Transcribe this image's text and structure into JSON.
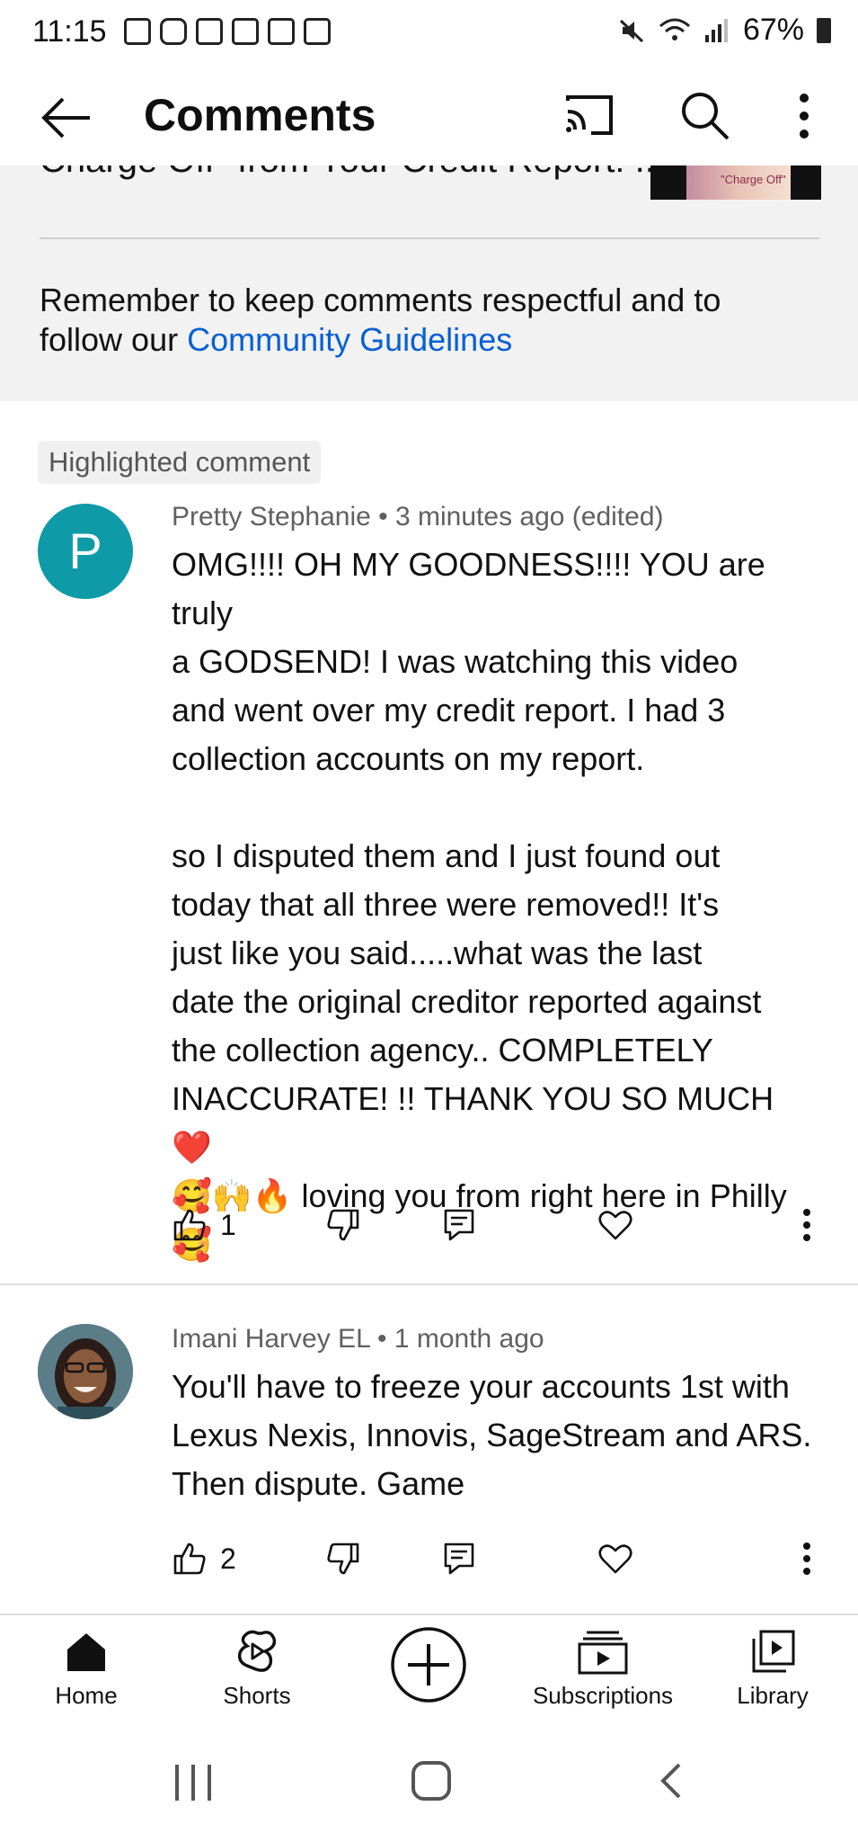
{
  "status_bar": {
    "time": "11:15",
    "battery": "67%"
  },
  "header": {
    "title": "Comments"
  },
  "video": {
    "title": "Charge Off\" from Your Credit Report! ...",
    "thumbnail_caption": "\"Charge Off\""
  },
  "reminder": {
    "text": "Remember to keep comments respectful and to follow our ",
    "link": "Community Guidelines"
  },
  "highlighted_label": "Highlighted comment",
  "comments": [
    {
      "avatar_letter": "P",
      "author": "Pretty Stephanie",
      "time": "3 minutes ago (edited)",
      "text": "OMG!!!! OH MY GOODNESS!!!! YOU are truly\na GODSEND! I was watching this video\nand went over my credit report. I had 3\ncollection accounts on my report.\n\nso I disputed them and I just found out\ntoday that all three were removed!! It's\njust like you said.....what was the last\ndate the original creditor reported against\nthe collection agency.. COMPLETELY\nINACCURATE! !! THANK YOU SO MUCH ❤️\n🥰🙌🔥 loving you from right here in Philly\n🥰",
      "likes": "1"
    },
    {
      "author": "Imani Harvey EL",
      "time": "1 month ago",
      "text": "You'll have to freeze your accounts 1st with\nLexus Nexis, Innovis, SageStream and ARS.\nThen dispute. Game",
      "likes": "2"
    }
  ],
  "bottom_nav": [
    {
      "label": "Home",
      "icon": "home-icon"
    },
    {
      "label": "Shorts",
      "icon": "shorts-icon"
    },
    {
      "label": "",
      "icon": "create-icon"
    },
    {
      "label": "Subscriptions",
      "icon": "subscriptions-icon"
    },
    {
      "label": "Library",
      "icon": "library-icon"
    }
  ]
}
